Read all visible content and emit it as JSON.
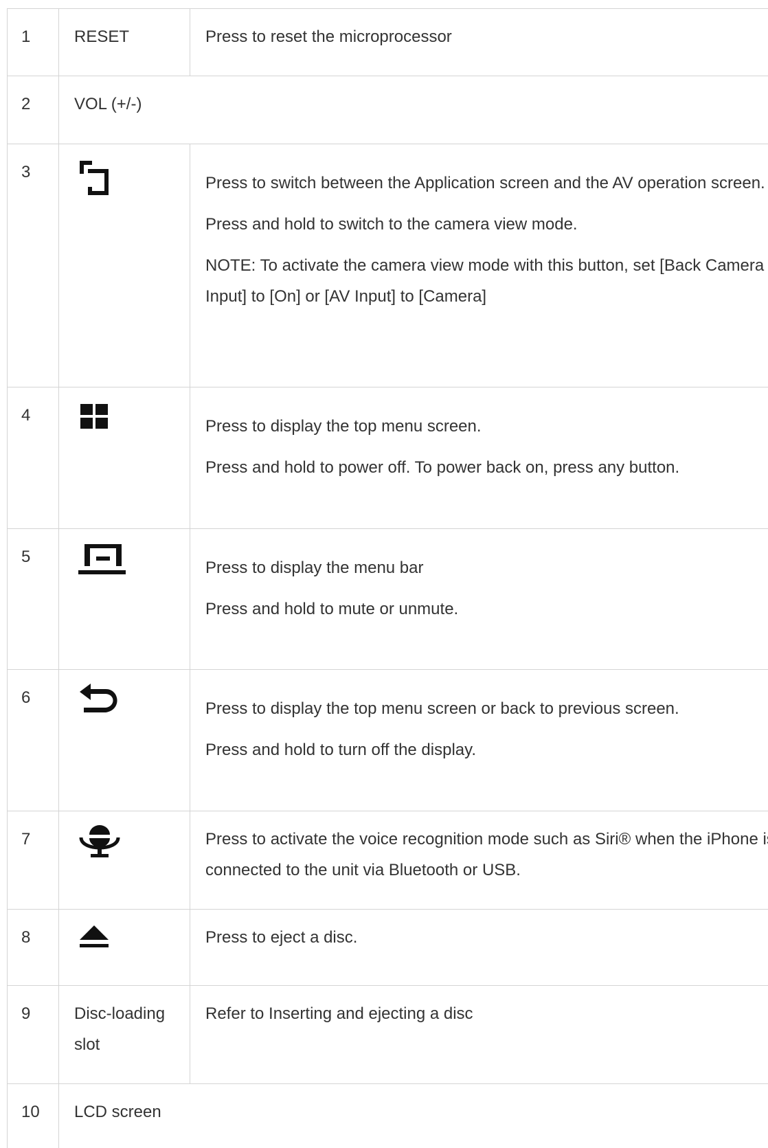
{
  "rows": [
    {
      "num": "1",
      "label": "RESET",
      "desc": [
        "Press to reset the microprocessor"
      ]
    },
    {
      "num": "2",
      "label": "VOL (+/-)"
    },
    {
      "num": "3",
      "icon": "screen-switch-icon",
      "desc": [
        "Press to switch between the Application screen and the AV operation screen.",
        "Press and hold to switch to the camera view mode.",
        "NOTE: To activate the camera view mode with this button, set [Back Camera Input] to [On] or [AV Input] to [Camera]"
      ]
    },
    {
      "num": "4",
      "icon": "grid-menu-icon",
      "desc": [
        "Press to display the top menu screen.",
        "Press and hold to power off. To power back on, press any button."
      ]
    },
    {
      "num": "5",
      "icon": "menu-bar-icon",
      "desc": [
        "Press to display the menu bar",
        "Press and hold to mute or unmute."
      ]
    },
    {
      "num": "6",
      "icon": "back-arrow-icon",
      "desc": [
        "Press to display the top menu screen or back to previous screen.",
        "Press and hold to turn off the display."
      ]
    },
    {
      "num": "7",
      "icon": "microphone-icon",
      "desc": [
        "Press to activate the voice recognition mode such as Siri® when the iPhone is connected to the unit via Bluetooth or USB."
      ]
    },
    {
      "num": "8",
      "icon": "eject-icon",
      "desc": [
        "Press to eject a disc."
      ]
    },
    {
      "num": "9",
      "label": "Disc-loading slot",
      "desc": [
        "Refer to Inserting and ejecting a disc"
      ]
    },
    {
      "num": "10",
      "label": "LCD screen"
    }
  ]
}
